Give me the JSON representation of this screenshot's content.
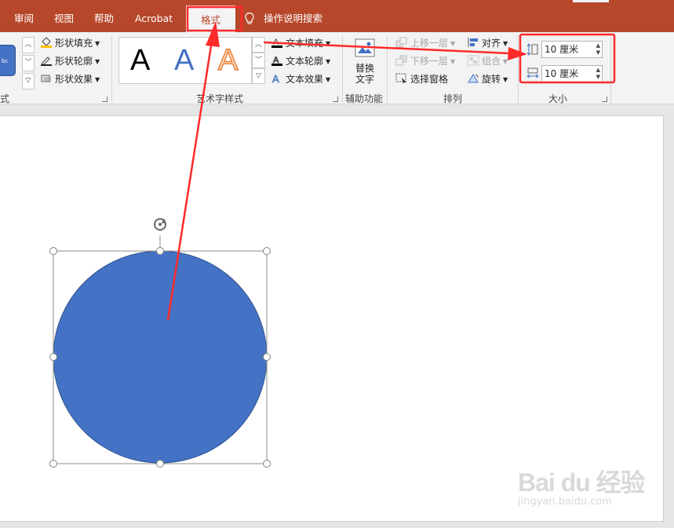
{
  "tabs": {
    "review": "审阅",
    "view": "视图",
    "help": "帮助",
    "acrobat": "Acrobat",
    "format": "格式",
    "tell_me": "操作说明搜索"
  },
  "ribbon": {
    "shape_styles": {
      "preview_text": "bc",
      "fill": "形状填充",
      "outline": "形状轮廓",
      "effects": "形状效果",
      "group_label": "式"
    },
    "wordart": {
      "letters": [
        "A",
        "A",
        "A"
      ],
      "text_fill": "文本填充",
      "text_outline": "文本轮廓",
      "text_effects": "文本效果",
      "group_label": "艺术字样式"
    },
    "accessibility": {
      "alt_text_line1": "替换",
      "alt_text_line2": "文字",
      "group_label": "辅助功能"
    },
    "arrange": {
      "bring_forward": "上移一层",
      "send_backward": "下移一层",
      "selection_pane": "选择窗格",
      "align": "对齐",
      "group": "组合",
      "rotate": "旋转",
      "group_label": "排列"
    },
    "size": {
      "height": "10 厘米",
      "width": "10 厘米",
      "group_label": "大小"
    }
  },
  "watermark": {
    "brand": "Bai du 经验",
    "url": "jingyan.baidu.com"
  },
  "colors": {
    "title_bar": "#b7472a",
    "shape_fill": "#4472c4",
    "annotation": "#ff2a2a"
  },
  "icons": [
    "lightbulb-icon",
    "paint-bucket-icon",
    "pen-icon",
    "shape-effects-icon",
    "text-fill-icon",
    "text-outline-icon",
    "text-effects-icon",
    "alt-text-icon",
    "bring-forward-icon",
    "send-backward-icon",
    "selection-pane-icon",
    "align-icon",
    "group-icon",
    "rotate-icon",
    "height-icon",
    "width-icon",
    "rotate-handle-icon"
  ]
}
